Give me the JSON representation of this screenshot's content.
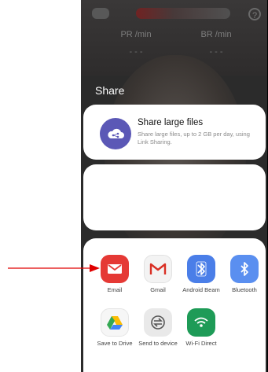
{
  "app_bg": {
    "metrics": [
      {
        "label": "PR /min",
        "value": "- - -"
      },
      {
        "label": "BR /min",
        "value": "- - -"
      }
    ],
    "help_glyph": "?"
  },
  "share_sheet": {
    "title": "Share",
    "large_files": {
      "title": "Share large files",
      "description": "Share large files, up to 2 GB per day, using Link Sharing."
    },
    "apps": [
      {
        "label": "Email",
        "icon": "email-icon"
      },
      {
        "label": "Gmail",
        "icon": "gmail-icon"
      },
      {
        "label": "Android Beam",
        "icon": "android-beam-icon"
      },
      {
        "label": "Bluetooth",
        "icon": "bluetooth-icon"
      },
      {
        "label": "Save to Drive",
        "icon": "drive-icon"
      },
      {
        "label": "Send to device",
        "icon": "send-to-device-icon"
      },
      {
        "label": "Wi-Fi Direct",
        "icon": "wifi-direct-icon"
      }
    ]
  },
  "colors": {
    "accent_arrow": "#e00000",
    "email": "#e53935",
    "bluetooth": "#5a8ff0",
    "wifi_direct": "#1e9b57",
    "link_sharing": "#5b58b6"
  }
}
